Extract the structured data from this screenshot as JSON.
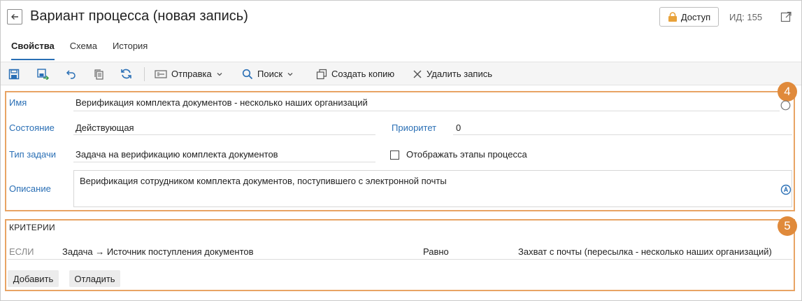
{
  "header": {
    "title": "Вариант процесса (новая запись)",
    "access_label": "Доступ",
    "id_label": "ИД: 155"
  },
  "tabs": [
    {
      "label": "Свойства",
      "active": true
    },
    {
      "label": "Схема",
      "active": false
    },
    {
      "label": "История",
      "active": false
    }
  ],
  "toolbar": {
    "send_label": "Отправка",
    "search_label": "Поиск",
    "copy_label": "Создать копию",
    "delete_label": "Удалить запись"
  },
  "section4": {
    "badge": "4",
    "name_label": "Имя",
    "name_value": "Верификация комплекта документов - несколько наших организаций",
    "state_label": "Состояние",
    "state_value": "Действующая",
    "priority_label": "Приоритет",
    "priority_value": "0",
    "task_type_label": "Тип задачи",
    "task_type_value": "Задача на верификацию комплекта документов",
    "show_stages_label": "Отображать этапы процесса",
    "description_label": "Описание",
    "description_value": "Верификация сотрудником комплекта документов, поступившего с электронной почты"
  },
  "section5": {
    "badge": "5",
    "title": "КРИТЕРИИ",
    "if_label": "ЕСЛИ",
    "field": "Задача → Источник поступления документов",
    "operator": "Равно",
    "value": "Захват с почты (пересылка - несколько наших организаций)",
    "add_label": "Добавить",
    "debug_label": "Отладить"
  },
  "colors": {
    "accent": "#2a6fb5",
    "highlight": "#e8a464",
    "badge": "#e08a3b"
  },
  "icons": [
    "back-arrow-icon",
    "lock-icon",
    "external-link-icon",
    "save-icon",
    "save-and-close-icon",
    "undo-icon",
    "copy-icon",
    "refresh-icon",
    "send-icon",
    "chevron-down-icon",
    "search-icon",
    "duplicate-icon",
    "close-icon",
    "spellcheck-icon"
  ]
}
